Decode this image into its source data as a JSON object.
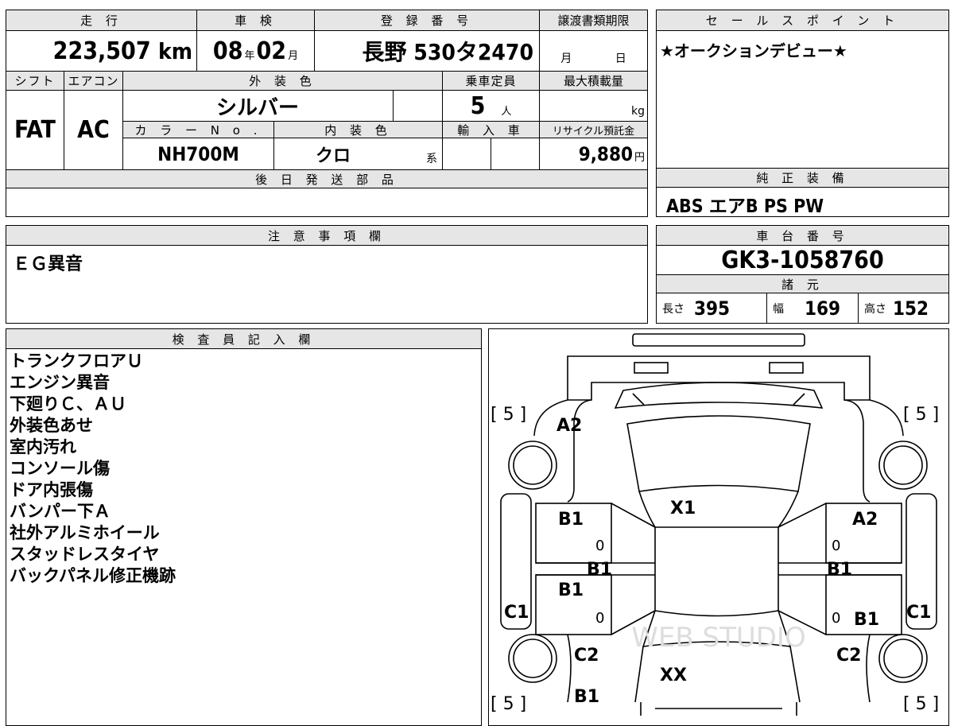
{
  "mileage": {
    "label": "走 行",
    "value": "223,507",
    "unit": "km"
  },
  "shaken": {
    "label": "車 検",
    "year": "08",
    "year_unit": "年",
    "month": "02",
    "month_unit": "月"
  },
  "registration": {
    "label": "登 録 番 号",
    "value": "長野 530タ2470"
  },
  "transfer_docs": {
    "label": "譲渡書類期限",
    "month_unit": "月",
    "day_unit": "日"
  },
  "sales_point": {
    "label": "セ ー ル ス ポ イ ン ト",
    "text": "★オークションデビュー★"
  },
  "shift": {
    "label": "シフト",
    "value": "FAT"
  },
  "aircon": {
    "label": "エアコン",
    "value": "AC"
  },
  "exterior_color": {
    "label": "外 装 色",
    "value": "シルバー"
  },
  "capacity": {
    "label": "乗車定員",
    "value": "5",
    "unit": "人"
  },
  "max_load": {
    "label": "最大積載量",
    "unit": "kg"
  },
  "color_no": {
    "label": "カ ラ ー N o .",
    "value": "NH700M"
  },
  "interior_color": {
    "label": "内 装 色",
    "value": "クロ",
    "unit": "系"
  },
  "import": {
    "label": "輸 入 車"
  },
  "recycle": {
    "label": "リサイクル預託金",
    "value": "9,880",
    "unit": "円"
  },
  "later_parts": {
    "label": "後 日 発 送 部 品"
  },
  "genuine_equipment": {
    "label": "純 正 装 備",
    "value": "ABS エアB PS PW"
  },
  "notes": {
    "label": "注 意 事 項 欄",
    "value": "ＥＧ異音"
  },
  "chassis": {
    "label": "車 台 番 号",
    "value": "GK3-1058760"
  },
  "specs": {
    "label": "諸 元",
    "length_label": "長さ",
    "length": "395",
    "width_label": "幅",
    "width": "169",
    "height_label": "高さ",
    "height": "152"
  },
  "inspector": {
    "label": "検 査 員 記 入 欄",
    "items": [
      "トランクフロアＵ",
      "エンジン異音",
      "下廻りＣ、ＡＵ",
      "外装色あせ",
      "室内汚れ",
      "コンソール傷",
      "ドア内張傷",
      "バンパー下Ａ",
      "社外アルミホイール",
      "スタッドレスタイヤ",
      "バックパネル修正機跡"
    ]
  },
  "diagram": {
    "tire_tl": "[ 5 ]",
    "tire_tr": "[ 5 ]",
    "tire_bl": "[ 5 ]",
    "tire_br": "[ 5 ]",
    "marks": {
      "a2_left": "A2",
      "a2_right": "A2",
      "x1": "X1",
      "b1_ldoor_f": "B1",
      "b1_ldoor_r": "B1",
      "b1_lmid": "B1",
      "b1_rmid": "B1",
      "b1_rdoor": "B1",
      "c1_left": "C1",
      "c1_right": "C1",
      "c2_left": "C2",
      "c2_right": "C2",
      "xx": "XX",
      "b1_bottom": "B1",
      "zero_1": "0",
      "zero_2": "0",
      "zero_3": "0",
      "zero_4": "0"
    },
    "watermark": "WEB STUDIO"
  }
}
